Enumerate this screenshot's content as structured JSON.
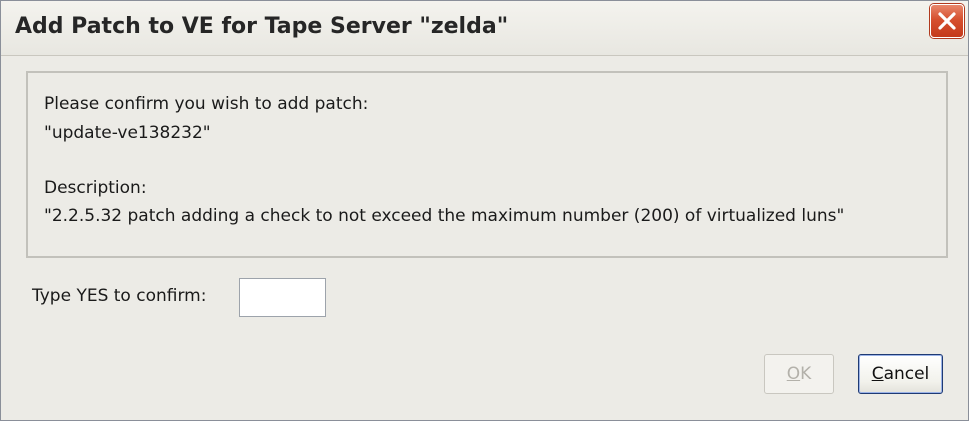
{
  "dialog": {
    "title": "Add Patch to VE for Tape Server \"zelda\"",
    "close_icon": "close-icon",
    "message": {
      "line1": "Please confirm you wish to add patch:",
      "line2": "\"update-ve138232\"",
      "line3": "Description:",
      "line4": "\"2.2.5.32 patch adding a check to not exceed the maximum number (200) of virtualized luns\""
    },
    "confirm": {
      "label": "Type YES to confirm:",
      "value": ""
    },
    "buttons": {
      "ok_mnemonic": "O",
      "ok_rest": "K",
      "ok_enabled": false,
      "cancel_mnemonic": "C",
      "cancel_rest": "ancel"
    }
  }
}
